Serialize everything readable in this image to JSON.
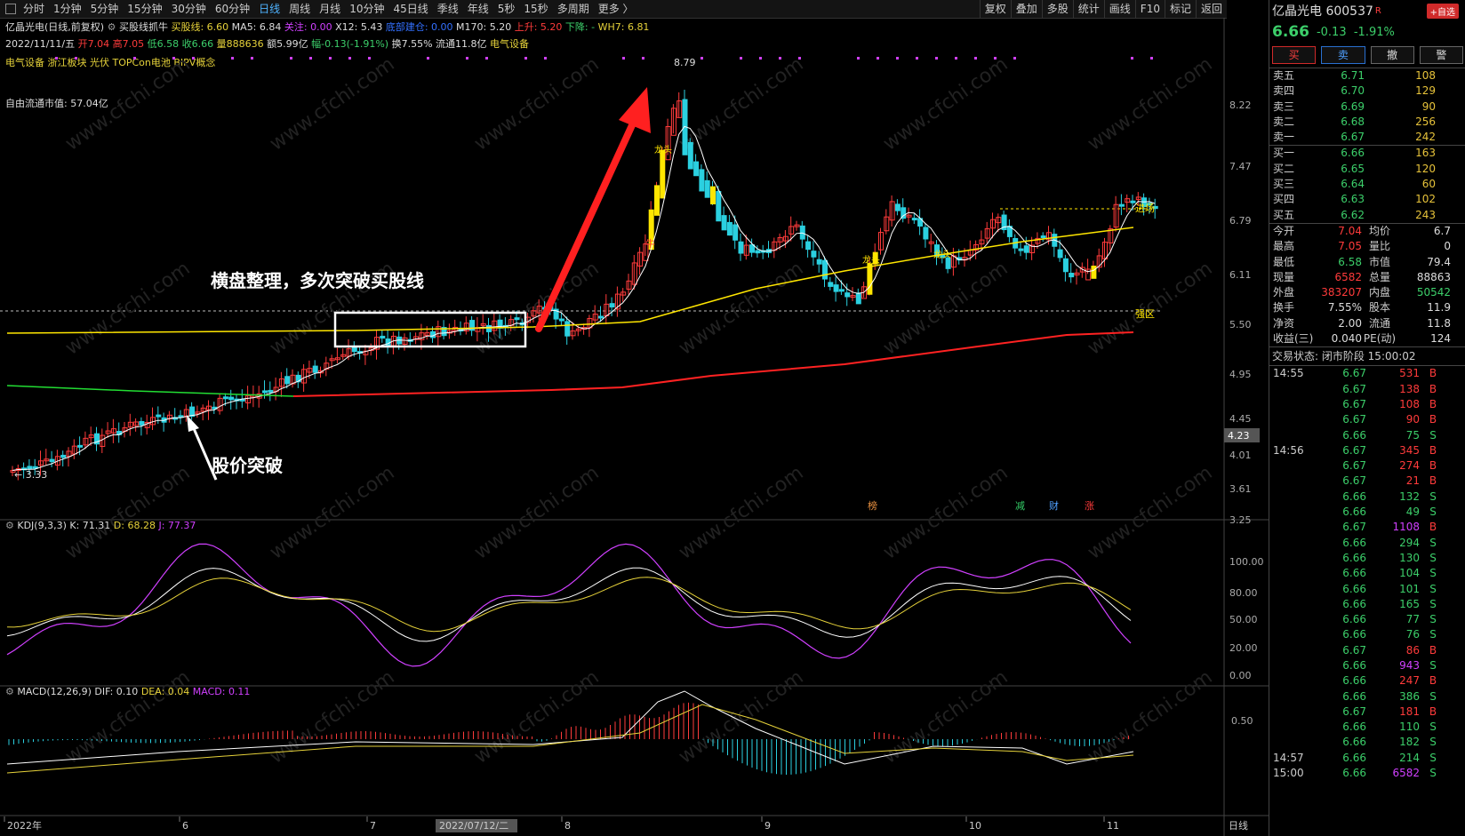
{
  "toolbar": {
    "periods": [
      "分时",
      "1分钟",
      "5分钟",
      "15分钟",
      "30分钟",
      "60分钟",
      "日线",
      "周线",
      "月线",
      "10分钟",
      "45日线",
      "季线",
      "年线",
      "5秒",
      "15秒",
      "多周期",
      "更多 〉"
    ],
    "active": "日线",
    "right": [
      "复权",
      "叠加",
      "多股",
      "统计",
      "画线",
      "F10",
      "标记",
      "返回"
    ]
  },
  "info": {
    "name": "亿晶光电",
    "mode": "(日线,前复权)",
    "indicator": "买股线抓牛",
    "maiguxian": "买股线: 6.60",
    "ma5": "MA5: 6.84",
    "guanzhu": "关注: 0.00",
    "x12": "X12: 5.43",
    "hidden": "底部建仓: 0.00",
    "m170": "M170: 5.20",
    "up": "上升: 5.20",
    "down": "下降: -",
    "wh7": "WH7: 6.81",
    "date": "2022/11/11/五",
    "open": "开7.04",
    "high": "高7.05",
    "low": "低6.58",
    "close": "收6.66",
    "vol": "量888636",
    "amt": "额5.99亿",
    "chg": "幅-0.13(-1.91%)",
    "turnover": "换7.55%",
    "float": "流通11.8亿",
    "sector": "电气设备",
    "concepts": "电气设备  浙江板块  光伏  TOPCon电池  BIPV概念",
    "free_cap": "自由流通市值: 57.04亿"
  },
  "annotations": {
    "box_text": "横盘整理，多次突破买股线",
    "break_text": "股价突破",
    "high_label": "8.79",
    "low_label": "3.33",
    "qiangqu": "强区",
    "jinchang": "进场",
    "niu": "牛",
    "longtou": "龙头",
    "zhao": "榜",
    "jian": "减",
    "cai": "财",
    "zhang": "涨"
  },
  "kdj": {
    "label": "KDJ(9,3,3)",
    "k": "K: 71.31",
    "d": "D: 68.28",
    "j": "J: 77.37"
  },
  "macd": {
    "label": "MACD(12,26,9)",
    "dif": "DIF: 0.10",
    "dea": "DEA: 0.04",
    "macd": "MACD: 0.11"
  },
  "axis": {
    "price_ticks": [
      "8.22",
      "7.47",
      "6.79",
      "6.11",
      "5.50",
      "4.95",
      "4.45",
      "4.01",
      "3.61",
      "3.25"
    ],
    "kdj_ticks": [
      "100.00",
      "80.00",
      "50.00",
      "20.00",
      "0.00"
    ],
    "macd_ticks": [
      "0.50"
    ],
    "cur_price": "4.23",
    "dates": [
      "2022年",
      "6",
      "7",
      "2022/07/12/二",
      "8",
      "9",
      "10",
      "11"
    ],
    "period": "日线"
  },
  "panel": {
    "title": "亿晶光电 600537",
    "badge": "R",
    "add": "+自选",
    "price": "6.66",
    "change": "-0.13",
    "pct": "-1.91%",
    "buttons": [
      "买",
      "卖",
      "撤",
      "警"
    ],
    "asks": [
      [
        "卖五",
        "6.71",
        "108"
      ],
      [
        "卖四",
        "6.70",
        "129"
      ],
      [
        "卖三",
        "6.69",
        "90"
      ],
      [
        "卖二",
        "6.68",
        "256"
      ],
      [
        "卖一",
        "6.67",
        "242"
      ]
    ],
    "bids": [
      [
        "买一",
        "6.66",
        "163"
      ],
      [
        "买二",
        "6.65",
        "120"
      ],
      [
        "买三",
        "6.64",
        "60"
      ],
      [
        "买四",
        "6.63",
        "102"
      ],
      [
        "买五",
        "6.62",
        "243"
      ]
    ],
    "stats": [
      [
        "今开",
        "7.04",
        "均价",
        "6.7"
      ],
      [
        "最高",
        "7.05",
        "量比",
        "0"
      ],
      [
        "最低",
        "6.58",
        "市值",
        "79.4"
      ],
      [
        "现量",
        "6582",
        "总量",
        "88863"
      ],
      [
        "外盘",
        "383207",
        "内盘",
        "50542"
      ],
      [
        "换手",
        "7.55%",
        "股本",
        "11.9"
      ],
      [
        "净资",
        "2.00",
        "流通",
        "11.8"
      ],
      [
        "收益(三)",
        "0.040",
        "PE(动)",
        "124"
      ]
    ],
    "status": "交易状态: 闭市阶段 15:00:02",
    "ticks": [
      [
        "14:55",
        "6.67",
        "531",
        "B"
      ],
      [
        "",
        "6.67",
        "138",
        "B"
      ],
      [
        "",
        "6.67",
        "108",
        "B"
      ],
      [
        "",
        "6.67",
        "90",
        "B"
      ],
      [
        "",
        "6.66",
        "75",
        "S"
      ],
      [
        "14:56",
        "6.67",
        "345",
        "B"
      ],
      [
        "",
        "6.67",
        "274",
        "B"
      ],
      [
        "",
        "6.67",
        "21",
        "B"
      ],
      [
        "",
        "6.66",
        "132",
        "S"
      ],
      [
        "",
        "6.66",
        "49",
        "S"
      ],
      [
        "",
        "6.67",
        "1108",
        "B"
      ],
      [
        "",
        "6.66",
        "294",
        "S"
      ],
      [
        "",
        "6.66",
        "130",
        "S"
      ],
      [
        "",
        "6.66",
        "104",
        "S"
      ],
      [
        "",
        "6.66",
        "101",
        "S"
      ],
      [
        "",
        "6.66",
        "165",
        "S"
      ],
      [
        "",
        "6.66",
        "77",
        "S"
      ],
      [
        "",
        "6.66",
        "76",
        "S"
      ],
      [
        "",
        "6.67",
        "86",
        "B"
      ],
      [
        "",
        "6.66",
        "943",
        "S"
      ],
      [
        "",
        "6.66",
        "247",
        "B"
      ],
      [
        "",
        "6.66",
        "386",
        "S"
      ],
      [
        "",
        "6.67",
        "181",
        "B"
      ],
      [
        "",
        "6.66",
        "110",
        "S"
      ],
      [
        "",
        "6.66",
        "182",
        "S"
      ],
      [
        "14:57",
        "6.66",
        "214",
        "S"
      ],
      [
        "15:00",
        "6.66",
        "6582",
        "S"
      ]
    ]
  },
  "colors": {
    "up": "#ff3b3b",
    "down": "#2bd0e0",
    "yellow": "#ffe600",
    "ma": "#ffffff",
    "purple": "#d040ff"
  }
}
